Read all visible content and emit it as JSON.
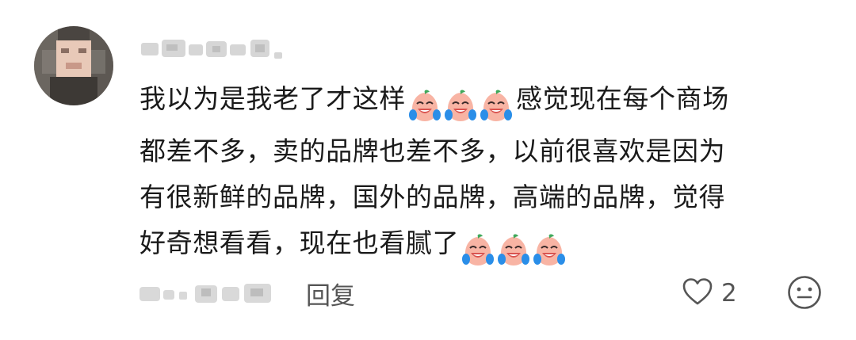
{
  "comment": {
    "avatar": "blurred-avatar",
    "username": "",
    "text_lines": [
      "我以为是我老了才这样",
      "感觉现在每个商场",
      "都差不多，卖的品牌也差不多，以前很喜欢是因为",
      "有很新鲜的品牌，国外的品牌，高端的品牌，觉得",
      "好奇想看看，现在也看腻了"
    ],
    "emoji_name": "crying-laughing-peach-emoji",
    "emoji_count_1": 3,
    "emoji_count_2": 3,
    "timestamp": "",
    "reply_label": "回复",
    "like_icon": "heart-outline-icon",
    "like_count": "2",
    "dislike_icon": "neutral-face-icon",
    "colors": {
      "text": "#1a1a1a",
      "meta": "#555555",
      "icon": "#555555",
      "emoji_fill": "#f8b4a4",
      "emoji_leaf": "#3fa85a",
      "emoji_tear": "#2a8ee8"
    }
  }
}
